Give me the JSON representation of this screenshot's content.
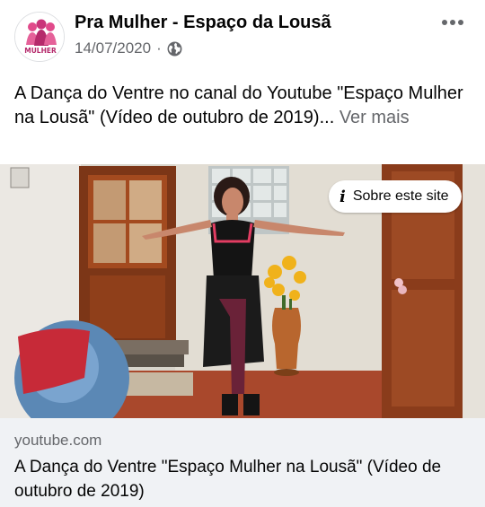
{
  "post": {
    "page_name": "Pra Mulher - Espaço da Lousã",
    "date": "14/07/2020",
    "separator": "·",
    "text": "A Dança do Ventre  no canal do Youtube \"Espaço Mulher na Lousã\" (Vídeo de outubro de 2019)...",
    "see_more_label": "Ver mais",
    "avatar_text": "MULHER"
  },
  "media": {
    "about_label": "Sobre este site",
    "info_glyph": "i"
  },
  "link_card": {
    "domain": "youtube.com",
    "title": "A Dança do Ventre \"Espaço Mulher na Lousã\" (Vídeo de outubro de 2019)"
  },
  "icons": {
    "more": "more-horizontal-icon",
    "privacy": "globe-icon",
    "info": "info-icon"
  }
}
